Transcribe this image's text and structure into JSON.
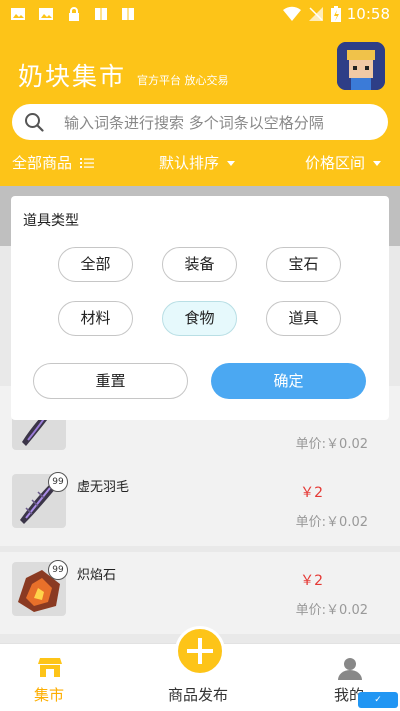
{
  "status_bar": {
    "time": "10:58"
  },
  "header": {
    "title": "奶块集市",
    "subtitle": "官方平台 放心交易"
  },
  "search": {
    "placeholder": "输入词条进行搜索 多个词条以空格分隔"
  },
  "filters": {
    "all_goods": "全部商品",
    "sort": "默认排序",
    "price_range": "价格区间"
  },
  "panel": {
    "title": "道具类型",
    "chips": [
      "全部",
      "装备",
      "宝石",
      "材料",
      "食物",
      "道具"
    ],
    "selected": "食物",
    "reset": "重置",
    "confirm": "确定"
  },
  "items": [
    {
      "badge": "",
      "name": "",
      "price": "",
      "unit": "单价:￥0.02"
    },
    {
      "badge": "99",
      "name": "虚无羽毛",
      "price": "￥2",
      "unit": "单价:￥0.02"
    },
    {
      "badge": "99",
      "name": "炽焰石",
      "price": "￥2",
      "unit": "单价:￥0.02"
    }
  ],
  "nav": {
    "market": "集市",
    "publish": "商品发布",
    "mine": "我的"
  },
  "colors": {
    "brand": "#fdc418",
    "confirm": "#4ba8f2",
    "price": "#e53935",
    "selected_chip": "#e6f9fc"
  }
}
